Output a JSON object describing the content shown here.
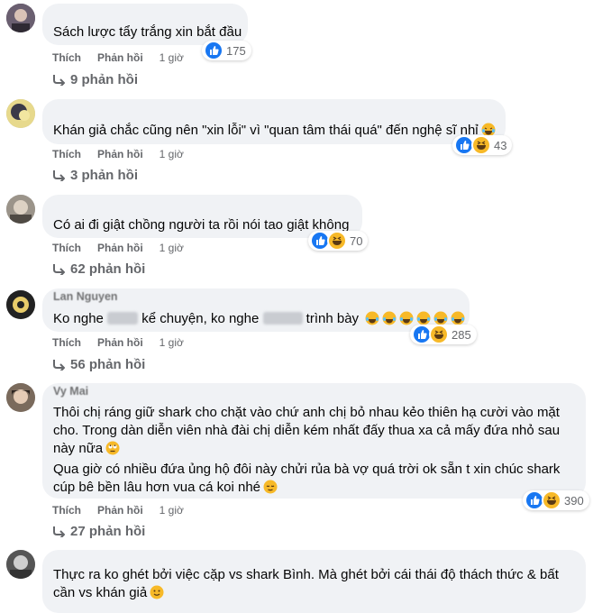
{
  "colors": {
    "bubble_bg": "#f0f2f5",
    "meta_text": "#65676b",
    "like_blue": "#1877f2",
    "haha_yellow": "#f7b928"
  },
  "comments": [
    {
      "author": "",
      "lines": [
        "Sách lược tẩy trắng xin bắt đầu"
      ],
      "actions": {
        "like": "Thích",
        "reply": "Phản hồi",
        "time": "1 giờ"
      },
      "reactions": {
        "icons": [
          "like-icon"
        ],
        "count": "175"
      },
      "replies": "9 phản hồi"
    },
    {
      "author": "",
      "lines": [
        "Khán giả chắc cũng nên \"xin lỗi\" vì \"quan tâm thái quá\" đến nghệ sĩ nhỉ"
      ],
      "actions": {
        "like": "Thích",
        "reply": "Phản hồi",
        "time": "1 giờ"
      },
      "reactions": {
        "icons": [
          "like-icon",
          "haha-icon"
        ],
        "count": "43"
      },
      "replies": "3 phản hồi"
    },
    {
      "author": "",
      "lines": [
        "Có ai đi giật chồng người ta rồi nói tao giật không"
      ],
      "actions": {
        "like": "Thích",
        "reply": "Phản hồi",
        "time": "1 giờ"
      },
      "reactions": {
        "icons": [
          "like-icon",
          "haha-icon"
        ],
        "count": "70"
      },
      "replies": "62 phản hồi"
    },
    {
      "author": "Lan Nguyen",
      "line_parts": [
        "Ko nghe",
        "kể chuyện, ko nghe",
        "trình bày"
      ],
      "actions": {
        "like": "Thích",
        "reply": "Phản hồi",
        "time": "1 giờ"
      },
      "reactions": {
        "icons": [
          "like-icon",
          "haha-icon"
        ],
        "count": "285"
      },
      "replies": "56 phản hồi"
    },
    {
      "author": "Vy Mai",
      "lines": [
        "Thôi chị ráng giữ shark cho chặt vào chứ anh chị bỏ nhau kẻo thiên hạ cười vào mặt",
        "cho. Trong dàn diễn viên nhà đài chị diễn kém nhất đấy thua xa cả mấy đứa nhỏ sau",
        "này nữa",
        "Qua giờ có nhiều đứa ủng hộ đôi này chửi rủa bà vợ quá trời ok sẵn t xin chúc shark",
        "cúp bê bền lâu hơn vua cá koi nhé"
      ],
      "actions": {
        "like": "Thích",
        "reply": "Phản hồi",
        "time": "1 giờ"
      },
      "reactions": {
        "icons": [
          "like-icon",
          "haha-icon"
        ],
        "count": "390"
      },
      "replies": "27 phản hồi"
    },
    {
      "author": "",
      "lines": [
        "Thực ra ko ghét bởi việc cặp vs shark Bình. Mà ghét bởi cái thái độ thách thức & bất",
        "cần vs khán giả"
      ]
    }
  ]
}
